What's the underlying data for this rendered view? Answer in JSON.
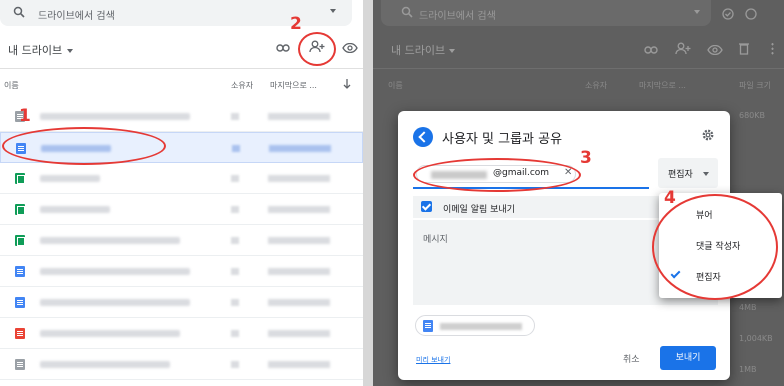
{
  "left": {
    "search": {
      "placeholder": "드라이브에서 검색"
    },
    "title": "내 드라이브",
    "columns": {
      "name": "이름",
      "owner": "소유자",
      "modified": "마지막으로 ..."
    },
    "rows": [
      {
        "type": "gen",
        "selected": false
      },
      {
        "type": "doc",
        "selected": true
      },
      {
        "type": "sheet",
        "selected": false
      },
      {
        "type": "sheet",
        "selected": false
      },
      {
        "type": "sheet",
        "selected": false
      },
      {
        "type": "doc",
        "selected": false
      },
      {
        "type": "doc",
        "selected": false
      },
      {
        "type": "pdf",
        "selected": false
      },
      {
        "type": "gen",
        "selected": false
      }
    ]
  },
  "right": {
    "search": {
      "placeholder": "드라이브에서 검색"
    },
    "title": "내 드라이브",
    "columns": {
      "name": "이름",
      "owner": "소유자",
      "modified": "마지막으로 ...",
      "size": "파일 크기"
    },
    "sizes": [
      "680KB",
      "4MB",
      "1,004KB",
      "1MB"
    ]
  },
  "dialog": {
    "title": "사용자 및 그룹과 공유",
    "email_suffix": "@gmail.com",
    "role": "편집자",
    "notify_label": "이메일 알림 보내기",
    "message_placeholder": "메시지",
    "preview_link": "미리 보내기",
    "cancel": "취소",
    "send": "보내기"
  },
  "role_menu": {
    "items": [
      "뷰어",
      "댓글 작성자",
      "편집자"
    ],
    "checked": "편집자"
  },
  "annotations": {
    "steps": [
      "1",
      "2",
      "3",
      "4"
    ],
    "color": "#e53935"
  },
  "colors": {
    "accent": "#1a73e8",
    "selected_row": "#e8f0fe"
  }
}
